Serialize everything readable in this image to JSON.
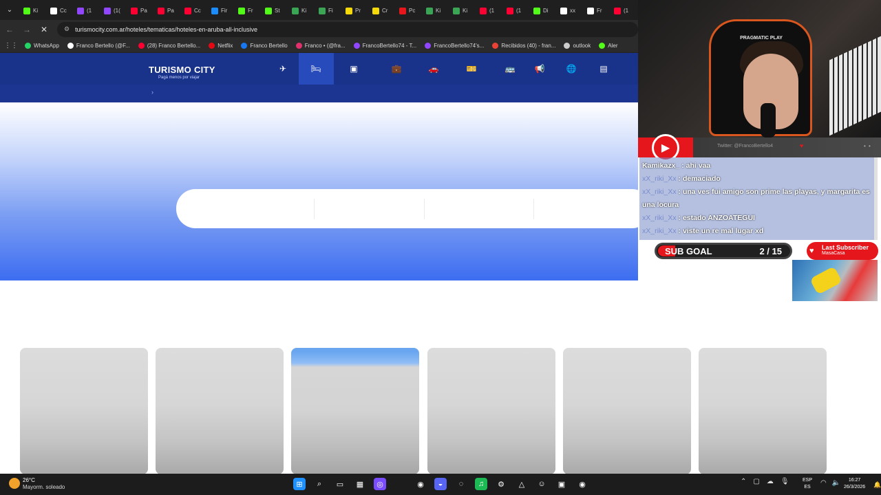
{
  "browser": {
    "tabs": [
      {
        "label": "Ki",
        "color": "#53fc18"
      },
      {
        "label": "Cc",
        "color": "#ffffff"
      },
      {
        "label": "(1",
        "color": "#9146ff"
      },
      {
        "label": "(1(",
        "color": "#9146ff"
      },
      {
        "label": "Pa",
        "color": "#ff0033"
      },
      {
        "label": "Pa",
        "color": "#ff0033"
      },
      {
        "label": "Cc",
        "color": "#ff0033"
      },
      {
        "label": "Fir",
        "color": "#1a8cff"
      },
      {
        "label": "Fr",
        "color": "#53fc18"
      },
      {
        "label": "St",
        "color": "#53fc18"
      },
      {
        "label": "Ki",
        "color": "#3aa655"
      },
      {
        "label": "Fi",
        "color": "#3aa655"
      },
      {
        "label": "Pr",
        "color": "#f5d90a"
      },
      {
        "label": "Cr",
        "color": "#f5d90a"
      },
      {
        "label": "Pc",
        "color": "#e5171c"
      },
      {
        "label": "Ki",
        "color": "#3aa655"
      },
      {
        "label": "Ki",
        "color": "#3aa655"
      },
      {
        "label": "(1",
        "color": "#ff0033"
      },
      {
        "label": "(1",
        "color": "#ff0033"
      },
      {
        "label": "Di",
        "color": "#53fc18"
      },
      {
        "label": "xx",
        "color": "#ffffff"
      },
      {
        "label": "Fr",
        "color": "#ffffff"
      },
      {
        "label": "(1",
        "color": "#ff0033"
      }
    ],
    "url": "turismocity.com.ar/hoteles/tematicas/hoteles-en-aruba-all-inclusive",
    "bookmarks": [
      {
        "label": "WhatsApp",
        "color": "#25d366"
      },
      {
        "label": "Franco Bertello (@F...",
        "color": "#ffffff"
      },
      {
        "label": "(28) Franco Bertello...",
        "color": "#ff0033"
      },
      {
        "label": "Netflix",
        "color": "#e50914"
      },
      {
        "label": "Franco Bertello",
        "color": "#1877f2"
      },
      {
        "label": "Franco • (@fra...",
        "color": "#e1306c"
      },
      {
        "label": "FrancoBertello74 - T...",
        "color": "#9146ff"
      },
      {
        "label": "FrancoBertello74's...",
        "color": "#9146ff"
      },
      {
        "label": "Recibidos (40) - fran...",
        "color": "#ea4335"
      },
      {
        "label": "outlook",
        "color": "#cccccc"
      },
      {
        "label": "Aler",
        "color": "#53fc18"
      }
    ]
  },
  "site": {
    "logo_main": "TURISMO CITY",
    "logo_tagline": "Pagá menos por viajar",
    "breadcrumb": "›",
    "nav": [
      {
        "icon": "plane-icon",
        "glyph": "✈"
      },
      {
        "icon": "bed-icon",
        "glyph": "🛏"
      },
      {
        "icon": "package-icon",
        "glyph": "▣"
      },
      {
        "icon": "suitcase-icon",
        "glyph": "💼"
      },
      {
        "icon": "car-icon",
        "glyph": "🚗"
      },
      {
        "icon": "ticket-icon",
        "glyph": "🎫"
      },
      {
        "icon": "bus-icon",
        "glyph": "🚌"
      },
      {
        "icon": "megaphone-icon",
        "glyph": "📢"
      },
      {
        "icon": "globe-icon",
        "glyph": "🌐"
      },
      {
        "icon": "document-icon",
        "glyph": "▤"
      }
    ]
  },
  "stream": {
    "chair_brand": "PRAGMATIC PLAY",
    "twitter": "Twitter: @FrancoBertello4",
    "chat": [
      {
        "user": "Kamikazx_",
        "message": " : ahi vaa",
        "user_alt": false
      },
      {
        "user": "xX_riki_Xx",
        "message": " : demaciado",
        "user_alt": true
      },
      {
        "user": "xX_riki_Xx",
        "message": " : una ves fui amigo son prime las playas, y margarita es una locura",
        "user_alt": true
      },
      {
        "user": "xX_riki_Xx",
        "message": " : estado ANZOATEGUI",
        "user_alt": true
      },
      {
        "user": "xX_riki_Xx",
        "message": " : viste un re mal lugar xd",
        "user_alt": true
      }
    ],
    "sub_goal_label": "SUB GOAL",
    "sub_goal_value": "2 / 15",
    "sub_goal_progress": 0.1333,
    "last_sub_title": "Last Subscriber",
    "last_sub_name": "MasaCasa"
  },
  "taskbar": {
    "temperature": "26°C",
    "weather": "Mayorm. soleado",
    "lang_top": "ESP",
    "lang_bottom": "ES",
    "time": "16:27",
    "date": "26/3/2026",
    "apps": [
      {
        "name": "windows-start-icon",
        "glyph": "⊞",
        "color": "#1e90ff"
      },
      {
        "name": "search-icon",
        "glyph": "⌕",
        "color": "transparent"
      },
      {
        "name": "task-view-icon",
        "glyph": "▭",
        "color": "transparent"
      },
      {
        "name": "store-icon",
        "glyph": "▦",
        "color": "transparent"
      },
      {
        "name": "app-circle-icon",
        "glyph": "◎",
        "color": "#7a4cff"
      },
      {
        "name": "chrome-icon",
        "glyph": "◉",
        "color": "transparent"
      },
      {
        "name": "discord-icon",
        "glyph": "◒",
        "color": "#5865f2"
      },
      {
        "name": "obs-icon",
        "glyph": "◌",
        "color": "transparent"
      },
      {
        "name": "spotify-icon",
        "glyph": "♫",
        "color": "#1db954"
      },
      {
        "name": "steam-icon",
        "glyph": "⚙",
        "color": "transparent"
      },
      {
        "name": "app-triangle-icon",
        "glyph": "△",
        "color": "transparent"
      },
      {
        "name": "app-people-icon",
        "glyph": "☺",
        "color": "transparent"
      },
      {
        "name": "monitor-icon",
        "glyph": "▣",
        "color": "transparent"
      },
      {
        "name": "chrome-2-icon",
        "glyph": "◉",
        "color": "transparent"
      }
    ]
  }
}
